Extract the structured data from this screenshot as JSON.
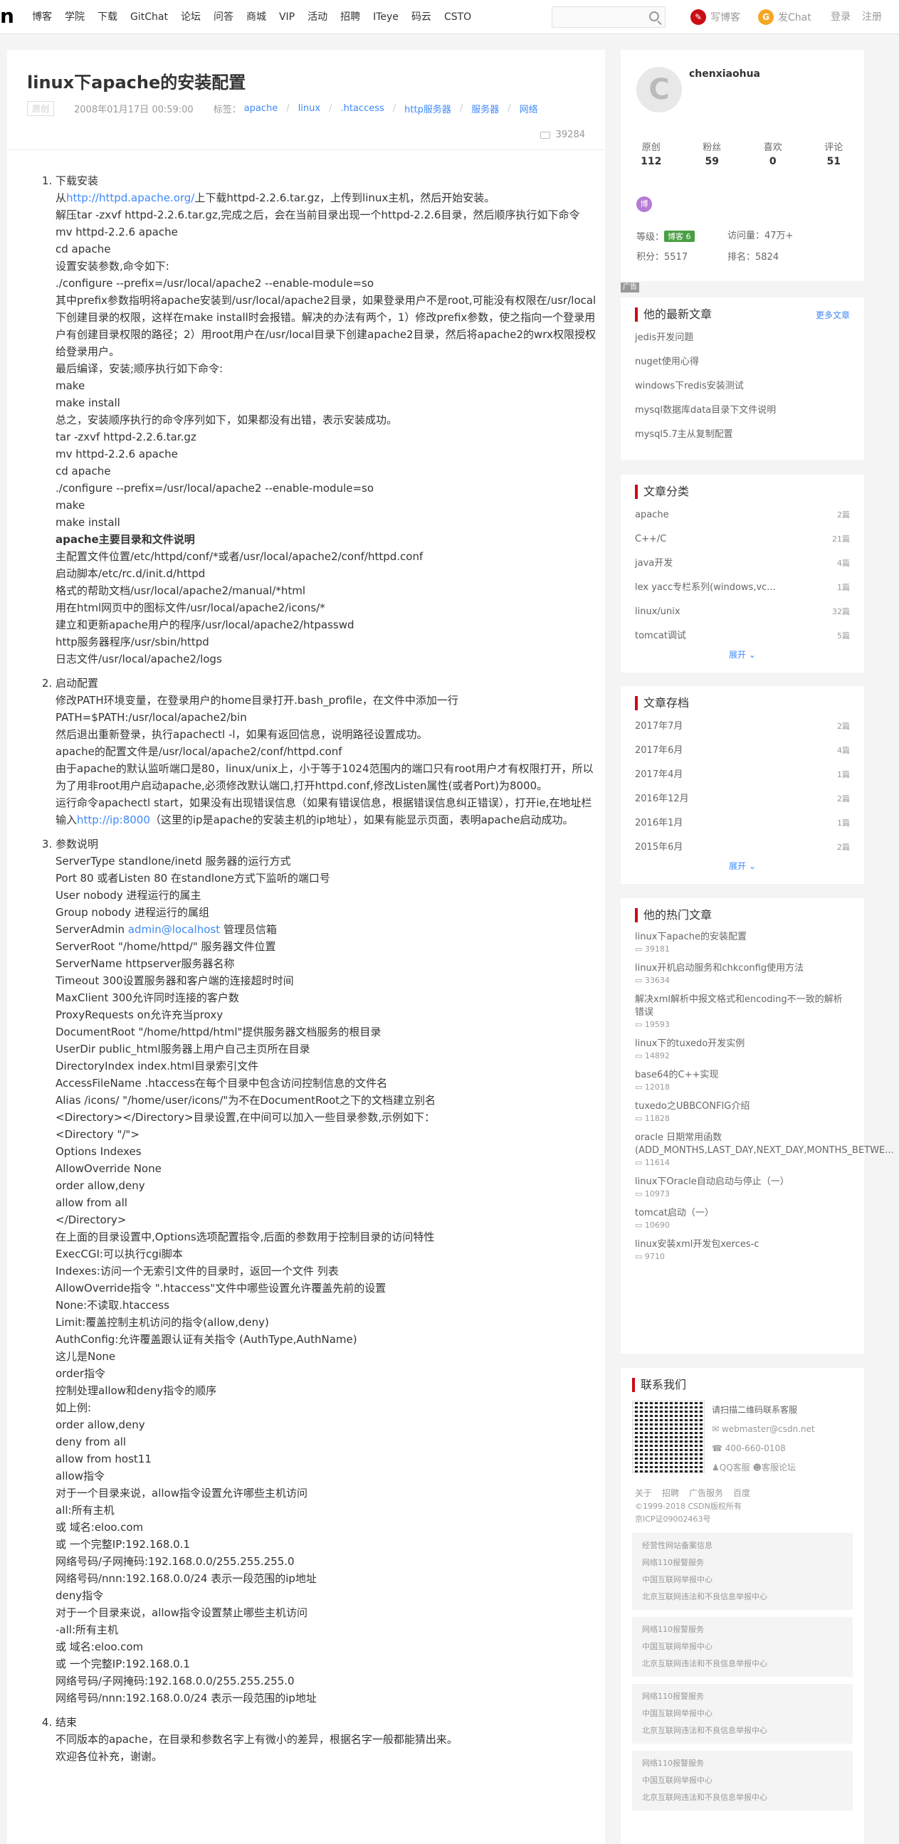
{
  "topbar": {
    "logo": "n",
    "nav": [
      "博客",
      "学院",
      "下载",
      "GitChat",
      "论坛",
      "问答",
      "商城",
      "VIP",
      "活动",
      "招聘",
      "ITeye",
      "码云",
      "CSTO"
    ],
    "write_blog": "写博客",
    "gitchat": "发Chat",
    "login": "登录",
    "register": "注册",
    "write_icon": "pen-icon",
    "chat_icon": "chat-icon"
  },
  "article": {
    "title": "linux下apache的安装配置",
    "original_badge": "原创",
    "date": "2008年01月17日 00:59:00",
    "tags_label": "标签：",
    "tags": [
      "apache",
      "linux",
      ".htaccess",
      "http服务器",
      "服务器",
      "网络"
    ],
    "views": "39284"
  },
  "content": {
    "s1": {
      "title": "下载安装",
      "link": "http://httpd.apache.org/",
      "l0": "从",
      "l0b": "上下载httpd-2.2.6.tar.gz，上传到linux主机，然后开始安装。",
      "lines": [
        "解压tar -zxvf httpd-2.2.6.tar.gz,完成之后，会在当前目录出现一个httpd-2.2.6目录，然后顺序执行如下命令",
        "mv httpd-2.2.6 apache",
        "cd apache",
        "设置安装参数,命令如下:",
        "./configure --prefix=/usr/local/apache2 --enable-module=so",
        "其中prefix参数指明将apache安装到/usr/local/apache2目录，如果登录用户不是root,可能没有权限在/usr/local下创建目录的权限，这样在make install时会报错。解决的办法有两个，1）修改prefix参数，使之指向一个登录用户有创建目录权限的路径；2）用root用户在/usr/local目录下创建apache2目录，然后将apache2的wrx权限授权给登录用户。",
        "最后编译，安装;顺序执行如下命令:",
        "make",
        "make install",
        "总之，安装顺序执行的命令序列如下，如果都没有出错，表示安装成功。",
        "tar -zxvf httpd-2.2.6.tar.gz",
        "mv httpd-2.2.6 apache",
        "cd apache",
        "./configure --prefix=/usr/local/apache2 --enable-module=so",
        "make",
        "make install"
      ],
      "bold": "apache主要目录和文件说明",
      "lines2": [
        "主配置文件位置/etc/httpd/conf/*或者/usr/local/apache2/conf/httpd.conf",
        "启动脚本/etc/rc.d/init.d/httpd",
        "格式的帮助文档/usr/local/apache2/manual/*html",
        "用在html网页中的图标文件/usr/local/apache2/icons/*",
        "建立和更新apache用户的程序/usr/local/apache2/htpasswd",
        "http服务器程序/usr/sbin/httpd",
        "日志文件/usr/local/apache2/logs"
      ]
    },
    "s2": {
      "title": "启动配置",
      "lines": [
        "修改PATH环境变量，在登录用户的home目录打开.bash_profile，在文件中添加一行",
        "PATH=$PATH:/usr/local/apache2/bin",
        "然后退出重新登录，执行apachectl -l，如果有返回信息，说明路径设置成功。",
        "apache的配置文件是/usr/local/apache2/conf/httpd.conf",
        "由于apache的默认监听端口是80，linux/unix上，小于等于1024范围内的端口只有root用户才有权限打开，所以为了用非root用户启动apache,必须修改默认端口,打开httpd.conf,修改Listen属性(或者Port)为8000。"
      ],
      "p_a": "运行命令apachectl start，如果没有出现错误信息（如果有错误信息，根据错误信息纠正错误），打开ie,在地址栏输入",
      "link": "http://ip:8000",
      "p_b": "（这里的ip是apache的安装主机的ip地址），如果有能显示页面，表明apache启动成功。"
    },
    "s3": {
      "title": "参数说明",
      "lines_a": [
        "ServerType standlone/inetd 服务器的运行方式",
        "Port 80 或者Listen 80 在standlone方式下监听的端口号",
        "User nobody 进程运行的属主",
        "Group nobody 进程运行的属组"
      ],
      "admin_a": "ServerAdmin ",
      "admin_link": "admin@localhost",
      "admin_b": " 管理员信箱",
      "lines_b": [
        "ServerRoot \"/home/httpd/\" 服务器文件位置",
        "ServerName httpserver服务器名称",
        "Timeout 300设置服务器和客户端的连接超时时间",
        "MaxClient 300允许同时连接的客户数",
        "ProxyRequests on允许充当proxy",
        "DocumentRoot \"/home/httpd/html\"提供服务器文档服务的根目录",
        "UserDir public_html服务器上用户自己主页所在目录",
        "DirectoryIndex index.html目录索引文件",
        "AccessFileName .htaccess在每个目录中包含访问控制信息的文件名",
        "Alias /icons/ \"/home/user/icons/\"为不在DocumentRoot之下的文档建立别名",
        "<Directory></Directory>目录设置,在中间可以加入一些目录参数,示例如下：",
        "<Directory \"/\">",
        "Options Indexes",
        "AllowOverride None",
        "order allow,deny",
        "allow from all",
        "</Directory>",
        "在上面的目录设置中,Options选项配置指令,后面的参数用于控制目录的访问特性",
        "ExecCGI:可以执行cgi脚本",
        "Indexes:访问一个无索引文件的目录时，返回一个文件 列表",
        "AllowOverride指令 \".htaccess\"文件中哪些设置允许覆盖先前的设置",
        "None:不读取.htaccess",
        "Limit:覆盖控制主机访问的指令(allow,deny)",
        "AuthConfig:允许覆盖跟认证有关指令 (AuthType,AuthName)",
        "这儿是None",
        "order指令",
        "控制处理allow和deny指令的顺序",
        "如上例:",
        "order allow,deny",
        "deny from all",
        "allow from host11",
        "allow指令",
        "对于一个目录来说，allow指令设置允许哪些主机访问",
        "all:所有主机",
        "或 域名:eloo.com",
        "或 一个完整IP:192.168.0.1",
        "网络号码/子网掩码:192.168.0.0/255.255.255.0",
        "网络号码/nnn:192.168.0.0/24 表示一段范围的ip地址",
        "deny指令",
        "对于一个目录来说，allow指令设置禁止哪些主机访问",
        "-all:所有主机",
        "或 域名:eloo.com",
        "或 一个完整IP:192.168.0.1",
        "网络号码/子网掩码:192.168.0.0/255.255.255.0",
        "网络号码/nnn:192.168.0.0/24 表示一段范围的ip地址"
      ]
    },
    "s4": {
      "title": "结束",
      "lines": [
        "不同版本的apache，在目录和参数名字上有微小的差异，根据名字一般都能猜出来。",
        "欢迎各位补充，谢谢。"
      ]
    }
  },
  "profile": {
    "name": "chenxiaohua",
    "avatar_letter": "C",
    "stats": [
      {
        "label": "原创",
        "value": "112"
      },
      {
        "label": "粉丝",
        "value": "59"
      },
      {
        "label": "喜欢",
        "value": "0"
      },
      {
        "label": "评论",
        "value": "51"
      }
    ],
    "level_label": "等级：",
    "level_badge": "博客 6",
    "visits_label": "访问量：",
    "visits": "47万+",
    "score_label": "积分：",
    "score": "5517",
    "rank_label": "排名：",
    "rank": "5824",
    "medal_icon": "medal-icon"
  },
  "ad_label": "广告",
  "latest": {
    "title": "他的最新文章",
    "more": "更多文章",
    "items": [
      "jedis开发问题",
      "nuget使用心得",
      "windows下redis安装测试",
      "mysql数据库data目录下文件说明",
      "mysql5.7主从复制配置"
    ]
  },
  "categories": {
    "title": "文章分类",
    "items": [
      {
        "name": "apache",
        "count": "2篇"
      },
      {
        "name": "C++/C",
        "count": "21篇"
      },
      {
        "name": "java开发",
        "count": "4篇"
      },
      {
        "name": "lex yacc专栏系列(windows,vc...",
        "count": "1篇"
      },
      {
        "name": "linux/unix",
        "count": "32篇"
      },
      {
        "name": "tomcat调试",
        "count": "5篇"
      }
    ],
    "expand": "展开"
  },
  "archive": {
    "title": "文章存档",
    "items": [
      {
        "name": "2017年7月",
        "count": "2篇"
      },
      {
        "name": "2017年6月",
        "count": "4篇"
      },
      {
        "name": "2017年4月",
        "count": "1篇"
      },
      {
        "name": "2016年12月",
        "count": "2篇"
      },
      {
        "name": "2016年1月",
        "count": "1篇"
      },
      {
        "name": "2015年6月",
        "count": "2篇"
      }
    ],
    "expand": "展开"
  },
  "hot": {
    "title": "他的热门文章",
    "items": [
      {
        "title": "linux下apache的安装配置",
        "views": "39181"
      },
      {
        "title": "linux开机启动服务和chkconfig使用方法",
        "views": "33634"
      },
      {
        "title": "解决xml解析中报文格式和encoding不一致的解析错误",
        "views": "19593"
      },
      {
        "title": "linux下的tuxedo开发实例",
        "views": "14892"
      },
      {
        "title": "base64的C++实现",
        "views": "12018"
      },
      {
        "title": "tuxedo之UBBCONFIG介绍",
        "views": "11828"
      },
      {
        "title": "oracle 日期常用函数 (ADD_MONTHS,LAST_DAY,NEXT_DAY,MONTHS_BETWE...",
        "views": "11614"
      },
      {
        "title": "linux下Oracle自动启动与停止（一）",
        "views": "10973"
      },
      {
        "title": "tomcat启动（一）",
        "views": "10690"
      },
      {
        "title": "linux安装xml开发包xerces-c",
        "views": "9710"
      }
    ]
  },
  "contact": {
    "title": "联系我们",
    "qr_text": "请扫描二维码联系客服",
    "email": "webmaster@csdn.net",
    "phone": "400-660-0108",
    "qq": "QQ客服",
    "forum": "客服论坛",
    "links": [
      "关于",
      "招聘",
      "广告服务",
      "百度"
    ],
    "copyright": "©1999-2018 CSDN版权所有",
    "icp": "京ICP证09002463号",
    "report_title": "经营性网站备案信息",
    "report": [
      "网络110报警服务",
      "中国互联网举报中心",
      "北京互联网违法和不良信息举报中心"
    ]
  }
}
